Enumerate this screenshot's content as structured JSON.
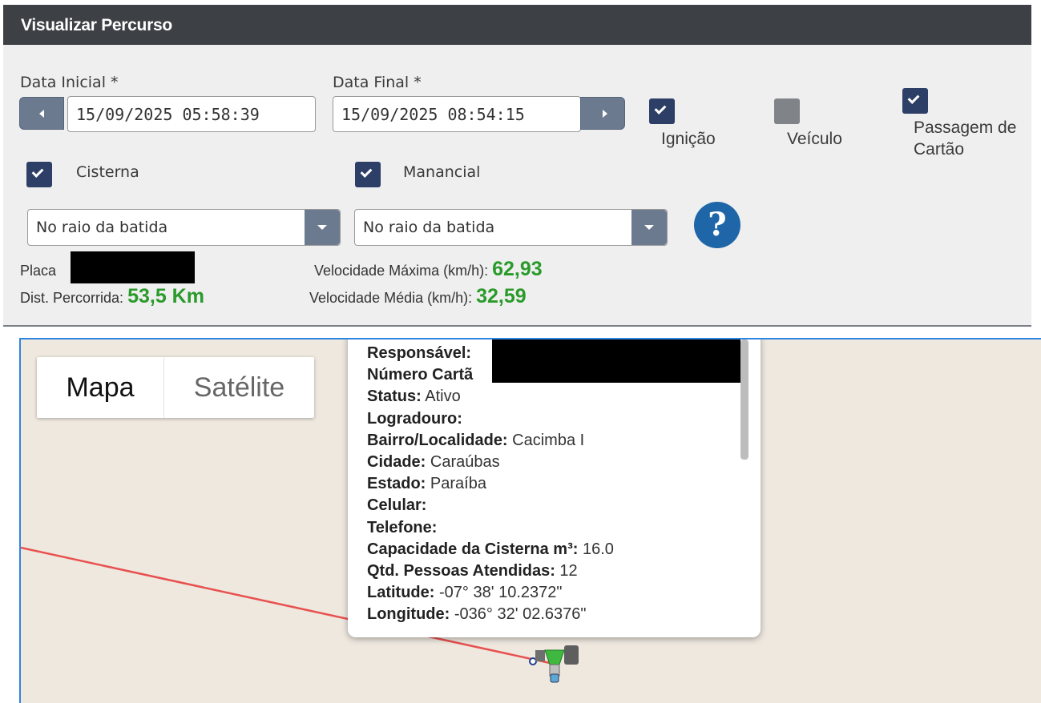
{
  "window": {
    "title": "Visualizar Percurso"
  },
  "filters": {
    "data_inicial_label": "Data Inicial *",
    "data_inicial_value": "15/09/2025 05:58:39",
    "data_final_label": "Data Final *",
    "data_final_value": "15/09/2025 08:54:15",
    "ignicao": {
      "label": "Ignição",
      "checked": true
    },
    "veiculo": {
      "label": "Veículo",
      "checked": false
    },
    "passagem": {
      "label_line1": "Passagem de",
      "label_line2": "Cartão",
      "checked": true
    },
    "cisterna": {
      "label": "Cisterna",
      "checked": true
    },
    "manancial": {
      "label": "Manancial",
      "checked": true
    },
    "select_cisterna": "No raio da batida",
    "select_manancial": "No raio da batida",
    "help_glyph": "?"
  },
  "stats": {
    "placa_label": "Placa",
    "dist_label": "Dist. Percorrida:",
    "dist_value": "53,5 Km",
    "vel_max_label": "Velocidade Máxima (km/h):",
    "vel_max_value": "62,93",
    "vel_media_label": "Velocidade Média (km/h):",
    "vel_media_value": "32,59"
  },
  "map": {
    "type_buttons": [
      "Mapa",
      "Satélite"
    ],
    "route_color": "#e8514f",
    "popup": {
      "rows": [
        {
          "key": "Responsável:",
          "value": ""
        },
        {
          "key": "Número Cartã",
          "value": ""
        },
        {
          "key": "Status:",
          "value": " Ativo"
        },
        {
          "key": "Logradouro:",
          "value": ""
        },
        {
          "key": "Bairro/Localidade:",
          "value": " Cacimba I"
        },
        {
          "key": "Cidade:",
          "value": " Caraúbas"
        },
        {
          "key": "Estado:",
          "value": " Paraíba"
        },
        {
          "key": "Celular:",
          "value": ""
        },
        {
          "key": "Telefone:",
          "value": ""
        },
        {
          "key": "Capacidade da Cisterna m³:",
          "value": " 16.0"
        },
        {
          "key": "Qtd. Pessoas Atendidas:",
          "value": " 12"
        },
        {
          "key": "Latitude:",
          "value": " -07° 38' 10.2372\""
        },
        {
          "key": "Longitude:",
          "value": " -036° 32' 02.6376\""
        }
      ]
    }
  },
  "colors": {
    "accent": "#2d3f66",
    "header": "#3d4045",
    "green_value": "#2a9a2a",
    "map_border": "#2f86e0"
  }
}
